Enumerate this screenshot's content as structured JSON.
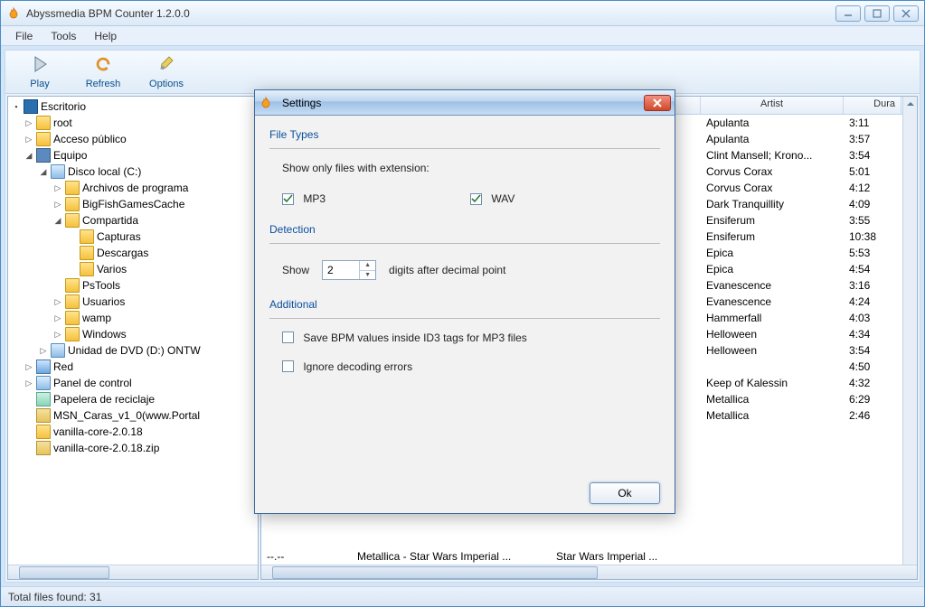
{
  "window": {
    "title": "Abyssmedia BPM Counter 1.2.0.0"
  },
  "menubar": {
    "file": "File",
    "tools": "Tools",
    "help": "Help"
  },
  "toolbar": {
    "play": "Play",
    "refresh": "Refresh",
    "options": "Options"
  },
  "tree": [
    {
      "label": "Escritorio",
      "indent": 0,
      "exp": "▪",
      "icon": "desktop"
    },
    {
      "label": "root",
      "indent": 1,
      "exp": "▷",
      "icon": "folder"
    },
    {
      "label": "Acceso público",
      "indent": 1,
      "exp": "▷",
      "icon": "folder"
    },
    {
      "label": "Equipo",
      "indent": 1,
      "exp": "◢",
      "icon": "computer"
    },
    {
      "label": "Disco local (C:)",
      "indent": 2,
      "exp": "◢",
      "icon": "drive"
    },
    {
      "label": "Archivos de programa",
      "indent": 3,
      "exp": "▷",
      "icon": "folder"
    },
    {
      "label": "BigFishGamesCache",
      "indent": 3,
      "exp": "▷",
      "icon": "folder"
    },
    {
      "label": "Compartida",
      "indent": 3,
      "exp": "◢",
      "icon": "folder"
    },
    {
      "label": "Capturas",
      "indent": 4,
      "exp": "",
      "icon": "folder"
    },
    {
      "label": "Descargas",
      "indent": 4,
      "exp": "",
      "icon": "folder"
    },
    {
      "label": "Varios",
      "indent": 4,
      "exp": "",
      "icon": "folder"
    },
    {
      "label": "PsTools",
      "indent": 3,
      "exp": "",
      "icon": "folder"
    },
    {
      "label": "Usuarios",
      "indent": 3,
      "exp": "▷",
      "icon": "folder"
    },
    {
      "label": "wamp",
      "indent": 3,
      "exp": "▷",
      "icon": "folder"
    },
    {
      "label": "Windows",
      "indent": 3,
      "exp": "▷",
      "icon": "folder"
    },
    {
      "label": "Unidad de DVD (D:) ONTW",
      "indent": 2,
      "exp": "▷",
      "icon": "drive"
    },
    {
      "label": "Red",
      "indent": 1,
      "exp": "▷",
      "icon": "network"
    },
    {
      "label": "Panel de control",
      "indent": 1,
      "exp": "▷",
      "icon": "drive"
    },
    {
      "label": "Papelera de reciclaje",
      "indent": 1,
      "exp": "",
      "icon": "recycle"
    },
    {
      "label": "MSN_Caras_v1_0(www.Portal",
      "indent": 1,
      "exp": "",
      "icon": "zip"
    },
    {
      "label": "vanilla-core-2.0.18",
      "indent": 1,
      "exp": "",
      "icon": "folder"
    },
    {
      "label": "vanilla-core-2.0.18.zip",
      "indent": 1,
      "exp": "",
      "icon": "zip"
    }
  ],
  "list": {
    "headers": {
      "artist": "Artist",
      "dura": "Dura"
    },
    "rows": [
      {
        "artist": "Apulanta",
        "dura": "3:11"
      },
      {
        "artist": "Apulanta",
        "dura": "3:57"
      },
      {
        "artist": "Clint Mansell; Krono...",
        "dura": "3:54"
      },
      {
        "artist": "Corvus Corax",
        "dura": "5:01"
      },
      {
        "artist": "Corvus Corax",
        "dura": "4:12"
      },
      {
        "artist": "Dark Tranquillity",
        "dura": "4:09"
      },
      {
        "artist": "Ensiferum",
        "dura": "3:55"
      },
      {
        "artist": "Ensiferum",
        "dura": "10:38"
      },
      {
        "artist": "Epica",
        "dura": "5:53"
      },
      {
        "artist": "Epica",
        "dura": "4:54"
      },
      {
        "artist": "Evanescence",
        "dura": "3:16"
      },
      {
        "artist": "Evanescence",
        "dura": "4:24"
      },
      {
        "artist": "Hammerfall",
        "dura": "4:03"
      },
      {
        "artist": "Helloween",
        "dura": "4:34"
      },
      {
        "artist": "Helloween",
        "dura": "3:54"
      },
      {
        "artist": "",
        "dura": "4:50"
      },
      {
        "artist": "Keep of Kalessin",
        "dura": "4:32"
      },
      {
        "artist": "Metallica",
        "dura": "6:29"
      },
      {
        "artist": "Metallica",
        "dura": "2:46"
      }
    ],
    "bottom_row": {
      "bpm": "--.--",
      "title": "Metallica - Star Wars Imperial ...",
      "album": "Star Wars Imperial ..."
    }
  },
  "status": "Total files found: 31",
  "dialog": {
    "title": "Settings",
    "group_filetypes": "File Types",
    "show_only_label": "Show only files with extension:",
    "mp3": "MP3",
    "mp3_checked": true,
    "wav": "WAV",
    "wav_checked": true,
    "group_detection": "Detection",
    "show_label": "Show",
    "digits_value": "2",
    "digits_after": "digits after decimal point",
    "group_additional": "Additional",
    "save_bpm": "Save BPM values inside ID3 tags for MP3 files",
    "save_bpm_checked": false,
    "ignore_errors": "Ignore decoding errors",
    "ignore_errors_checked": false,
    "ok": "Ok"
  }
}
